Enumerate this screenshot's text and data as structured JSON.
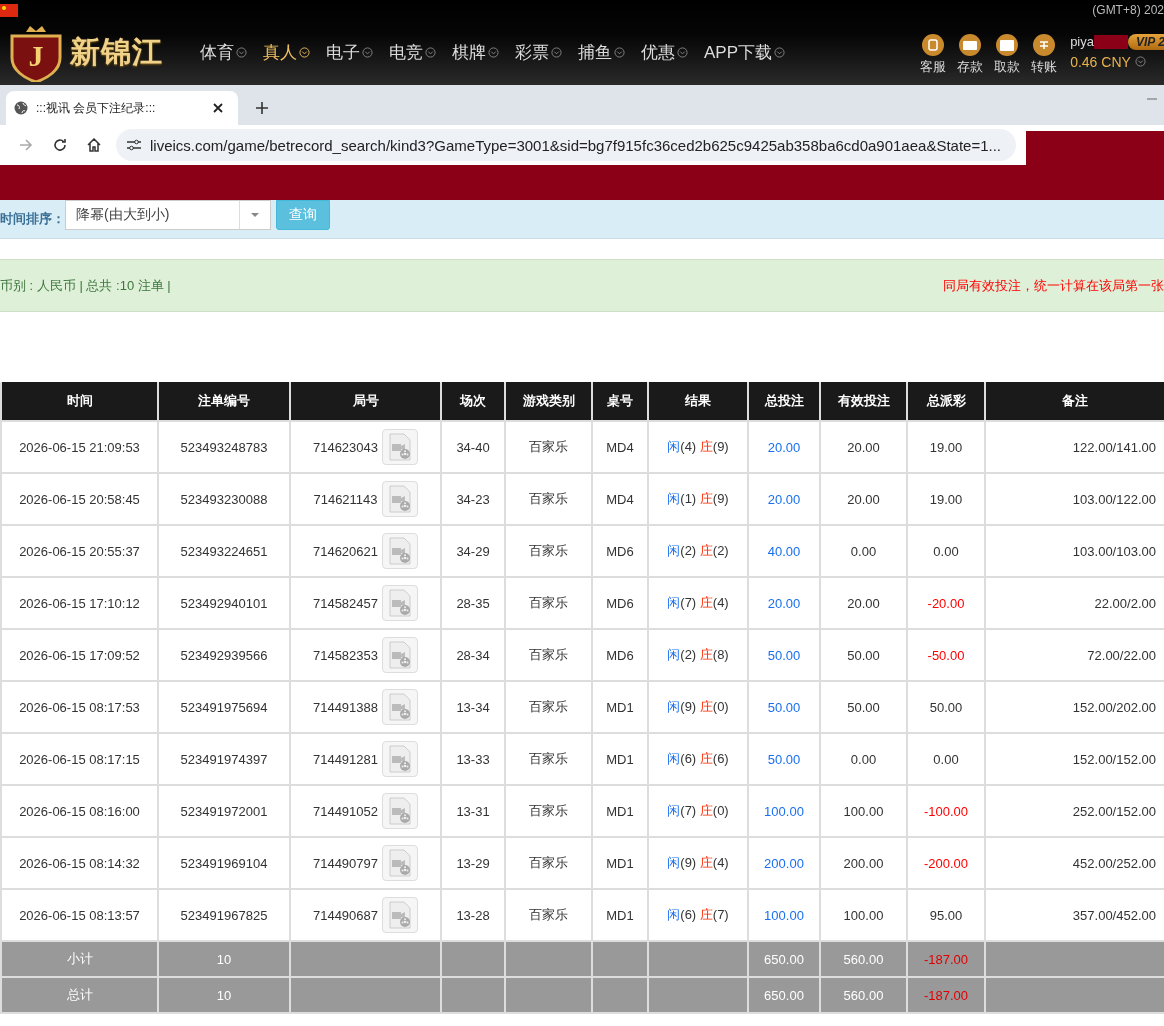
{
  "site": {
    "timezone": "(GMT+8) 202",
    "logo_text": "新锦江",
    "logo_letter": "J",
    "nav": [
      {
        "label": "体育",
        "selected": false
      },
      {
        "label": "真人",
        "selected": true
      },
      {
        "label": "电子",
        "selected": false
      },
      {
        "label": "电竞",
        "selected": false
      },
      {
        "label": "棋牌",
        "selected": false
      },
      {
        "label": "彩票",
        "selected": false
      },
      {
        "label": "捕鱼",
        "selected": false
      },
      {
        "label": "优惠",
        "selected": false
      },
      {
        "label": "APP下载",
        "selected": false
      }
    ],
    "actions": [
      {
        "kind": "service",
        "label": "客服"
      },
      {
        "kind": "deposit",
        "label": "存款"
      },
      {
        "kind": "withdraw",
        "label": "取款"
      },
      {
        "kind": "transfer",
        "label": "转账"
      }
    ],
    "user": "piya",
    "vip": "VIP 2",
    "balance": "0.46 CNY"
  },
  "browser": {
    "tab_title": ":::视讯 会员下注纪录:::",
    "url": "liveics.com/game/betrecord_search/kind3?GameType=3001&sid=bg7f915fc36ced2b625c9425ab358ba6cd0a901aea&State=1..."
  },
  "filter": {
    "label": "时间排序：",
    "sort_value": "降幂(由大到小)",
    "search_button": "查询"
  },
  "summary": {
    "info": "币别 : 人民币 | 总共 :10 注单 |",
    "notice": "同局有效投注，统一计算在该局第一张"
  },
  "table": {
    "columns": [
      "时间",
      "注单编号",
      "局号",
      "场次",
      "游戏类别",
      "桌号",
      "结果",
      "总投注",
      "有效投注",
      "总派彩",
      "备注"
    ],
    "rows": [
      {
        "time": "2026-06-15 21:09:53",
        "bet_id": "523493248783",
        "round": "714623043",
        "session": "34-40",
        "game": "百家乐",
        "table": "MD4",
        "player_label": "闲",
        "player": "(4)",
        "banker_label": "庄",
        "banker": "(9)",
        "total_bet": "20.00",
        "valid_bet": "20.00",
        "payout": "19.00",
        "payout_negative": false,
        "note": "122.00/141.00"
      },
      {
        "time": "2026-06-15 20:58:45",
        "bet_id": "523493230088",
        "round": "714621143",
        "session": "34-23",
        "game": "百家乐",
        "table": "MD4",
        "player_label": "闲",
        "player": "(1)",
        "banker_label": "庄",
        "banker": "(9)",
        "total_bet": "20.00",
        "valid_bet": "20.00",
        "payout": "19.00",
        "payout_negative": false,
        "note": "103.00/122.00"
      },
      {
        "time": "2026-06-15 20:55:37",
        "bet_id": "523493224651",
        "round": "714620621",
        "session": "34-29",
        "game": "百家乐",
        "table": "MD6",
        "player_label": "闲",
        "player": "(2)",
        "banker_label": "庄",
        "banker": "(2)",
        "total_bet": "40.00",
        "valid_bet": "0.00",
        "payout": "0.00",
        "payout_negative": false,
        "note": "103.00/103.00"
      },
      {
        "time": "2026-06-15 17:10:12",
        "bet_id": "523492940101",
        "round": "714582457",
        "session": "28-35",
        "game": "百家乐",
        "table": "MD6",
        "player_label": "闲",
        "player": "(7)",
        "banker_label": "庄",
        "banker": "(4)",
        "total_bet": "20.00",
        "valid_bet": "20.00",
        "payout": "-20.00",
        "payout_negative": true,
        "note": "22.00/2.00"
      },
      {
        "time": "2026-06-15 17:09:52",
        "bet_id": "523492939566",
        "round": "714582353",
        "session": "28-34",
        "game": "百家乐",
        "table": "MD6",
        "player_label": "闲",
        "player": "(2)",
        "banker_label": "庄",
        "banker": "(8)",
        "total_bet": "50.00",
        "valid_bet": "50.00",
        "payout": "-50.00",
        "payout_negative": true,
        "note": "72.00/22.00"
      },
      {
        "time": "2026-06-15 08:17:53",
        "bet_id": "523491975694",
        "round": "714491388",
        "session": "13-34",
        "game": "百家乐",
        "table": "MD1",
        "player_label": "闲",
        "player": "(9)",
        "banker_label": "庄",
        "banker": "(0)",
        "total_bet": "50.00",
        "valid_bet": "50.00",
        "payout": "50.00",
        "payout_negative": false,
        "note": "152.00/202.00"
      },
      {
        "time": "2026-06-15 08:17:15",
        "bet_id": "523491974397",
        "round": "714491281",
        "session": "13-33",
        "game": "百家乐",
        "table": "MD1",
        "player_label": "闲",
        "player": "(6)",
        "banker_label": "庄",
        "banker": "(6)",
        "total_bet": "50.00",
        "valid_bet": "0.00",
        "payout": "0.00",
        "payout_negative": false,
        "note": "152.00/152.00"
      },
      {
        "time": "2026-06-15 08:16:00",
        "bet_id": "523491972001",
        "round": "714491052",
        "session": "13-31",
        "game": "百家乐",
        "table": "MD1",
        "player_label": "闲",
        "player": "(7)",
        "banker_label": "庄",
        "banker": "(0)",
        "total_bet": "100.00",
        "valid_bet": "100.00",
        "payout": "-100.00",
        "payout_negative": true,
        "note": "252.00/152.00"
      },
      {
        "time": "2026-06-15 08:14:32",
        "bet_id": "523491969104",
        "round": "714490797",
        "session": "13-29",
        "game": "百家乐",
        "table": "MD1",
        "player_label": "闲",
        "player": "(9)",
        "banker_label": "庄",
        "banker": "(4)",
        "total_bet": "200.00",
        "valid_bet": "200.00",
        "payout": "-200.00",
        "payout_negative": true,
        "note": "452.00/252.00"
      },
      {
        "time": "2026-06-15 08:13:57",
        "bet_id": "523491967825",
        "round": "714490687",
        "session": "13-28",
        "game": "百家乐",
        "table": "MD1",
        "player_label": "闲",
        "player": "(6)",
        "banker_label": "庄",
        "banker": "(7)",
        "total_bet": "100.00",
        "valid_bet": "100.00",
        "payout": "95.00",
        "payout_negative": false,
        "note": "357.00/452.00"
      }
    ],
    "totals": [
      {
        "label": "小计",
        "count": "10",
        "total_bet": "650.00",
        "valid_bet": "560.00",
        "payout": "-187.00",
        "payout_negative": true
      },
      {
        "label": "总计",
        "count": "10",
        "total_bet": "650.00",
        "valid_bet": "560.00",
        "payout": "-187.00",
        "payout_negative": true
      }
    ]
  }
}
